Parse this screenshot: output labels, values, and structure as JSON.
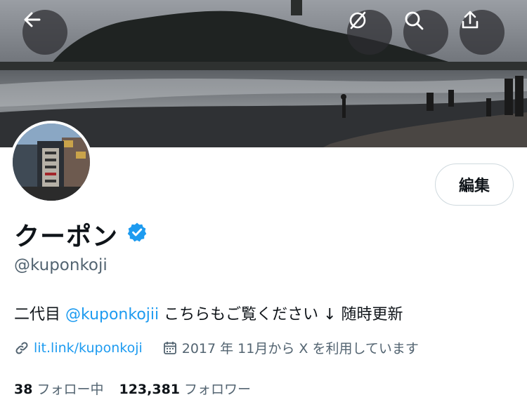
{
  "icons": {
    "back": "arrow-left-icon",
    "no_translate": "circle-slash-icon",
    "search": "search-icon",
    "share": "share-icon",
    "verified": "verified-badge-icon",
    "link": "link-icon",
    "calendar": "calendar-icon"
  },
  "colors": {
    "accent": "#1d9bf0",
    "secondary_text": "#536471",
    "primary_text": "#0f1419",
    "button_border": "#cfd9de"
  },
  "profile": {
    "edit_label": "編集",
    "display_name": "クーポン",
    "handle": "@kuponkoji",
    "bio": {
      "prefix": "二代目 ",
      "mention": "@kuponkojii",
      "suffix": " こちらもご覧ください ↓ 随時更新"
    },
    "link_text": "lit.link/kuponkoji",
    "joined_text": "2017 年 11月から X を利用しています",
    "following_count": "38",
    "following_label": "フォロー中",
    "followers_count": "123,381",
    "followers_label": "フォロワー"
  }
}
